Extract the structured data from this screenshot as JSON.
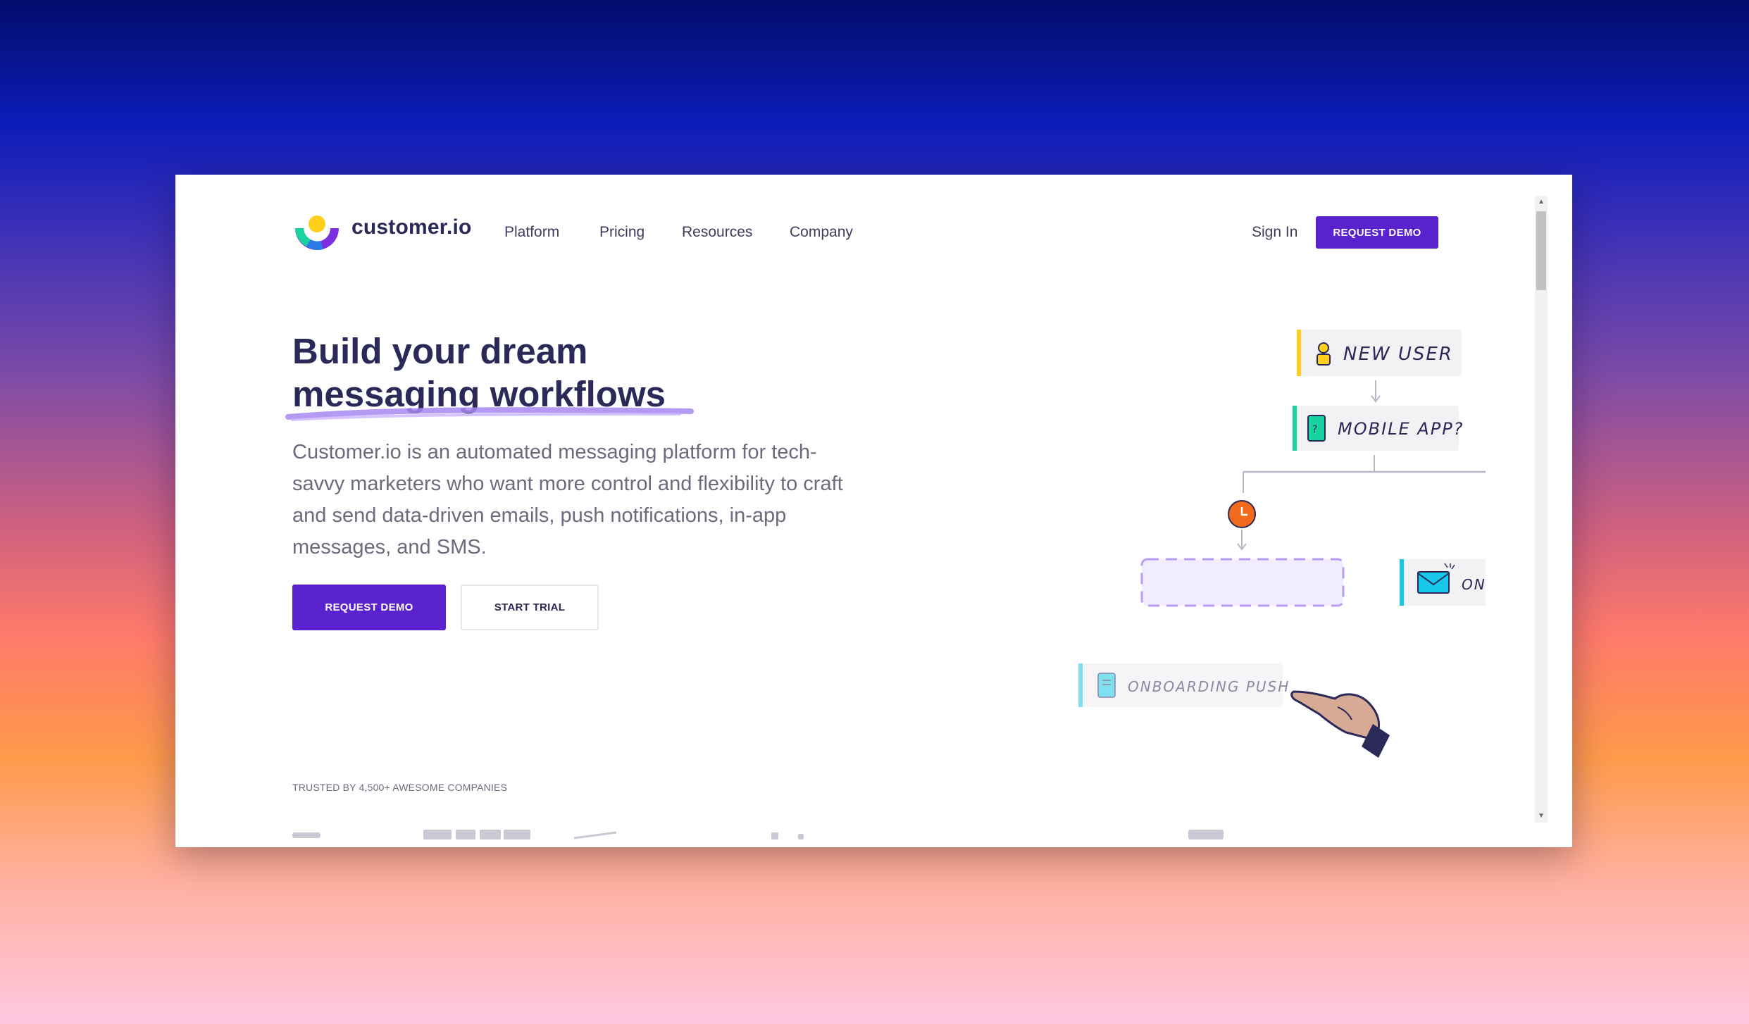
{
  "brand": {
    "name": "customer.io",
    "accent": "#5a21cf",
    "navy": "#2b2958"
  },
  "nav": {
    "items": [
      {
        "label": "Platform"
      },
      {
        "label": "Pricing"
      },
      {
        "label": "Resources"
      },
      {
        "label": "Company"
      }
    ],
    "signin": "Sign In",
    "cta": "REQUEST DEMO"
  },
  "hero": {
    "headline_line1": "Build your dream",
    "headline_line2": "messaging workflows",
    "body": "Customer.io is an automated messaging platform for tech-savvy marketers who want more control and flexibility to craft and send data-driven emails, push notifications, in-app messages, and SMS.",
    "primary_cta": "REQUEST DEMO",
    "secondary_cta": "START TRIAL"
  },
  "workflow": {
    "new_user": "NEW USER",
    "mobile_app": "MOBILE APP?",
    "onboarding_email": "ONBOARDING EMAIL",
    "onboarding_push": "ONBOARDING PUSH"
  },
  "trusted": {
    "label": "TRUSTED BY 4,500+ AWESOME COMPANIES"
  },
  "icons": [
    "logo-icon",
    "user-icon",
    "phone-icon",
    "timer-icon",
    "envelope-icon",
    "notification-icon",
    "pointing-hand-icon"
  ]
}
